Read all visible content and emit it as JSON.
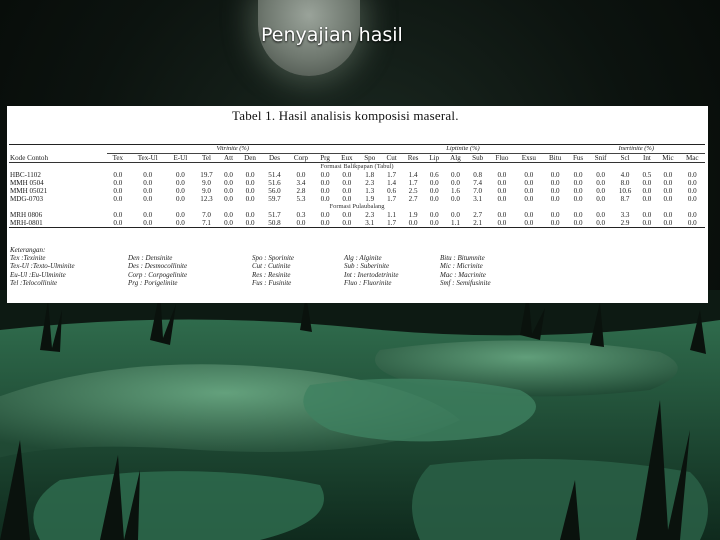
{
  "slide": {
    "title": "Penyajian hasil"
  },
  "table": {
    "caption": "Tabel 1. Hasil analisis komposisi maseral.",
    "groups": {
      "vitrinite": "Vitrinite (%)",
      "liptinite": "Liptinite (%)",
      "inertinite": "Inertinite (%)"
    },
    "kode_header": "Kode Contoh",
    "columns": [
      "Tex",
      "Tex-Ul",
      "E-Ul",
      "Tel",
      "Att",
      "Den",
      "Des",
      "Corp",
      "Prg",
      "Eux",
      "Spo",
      "Cut",
      "Res",
      "Lip",
      "Alg",
      "Sub",
      "Fluo",
      "Exsu",
      "Bitu",
      "Fus",
      "Snif",
      "Scl",
      "Int",
      "Mic",
      "Mac"
    ],
    "sections": [
      {
        "formation": "Formasi Balikpapan (Tabul)",
        "rows": [
          {
            "code": "HBC-1102",
            "values": [
              "0.0",
              "0.0",
              "0.0",
              "19.7",
              "0.0",
              "0.0",
              "51.4",
              "0.0",
              "0.0",
              "0.0",
              "1.8",
              "1.7",
              "1.4",
              "0.6",
              "0.0",
              "0.8",
              "0.0",
              "0.0",
              "0.0",
              "0.0",
              "0.0",
              "4.0",
              "0.5",
              "0.0",
              "0.0"
            ]
          },
          {
            "code": "MMH 0504",
            "values": [
              "0.0",
              "0.0",
              "0.0",
              "9.0",
              "0.0",
              "0.0",
              "51.6",
              "3.4",
              "0.0",
              "0.0",
              "2.3",
              "1.4",
              "1.7",
              "0.0",
              "0.0",
              "7.4",
              "0.0",
              "0.0",
              "0.0",
              "0.0",
              "0.0",
              "8.0",
              "0.0",
              "0.0",
              "0.0"
            ]
          },
          {
            "code": "MMH 05021",
            "values": [
              "0.0",
              "0.0",
              "0.0",
              "9.0",
              "0.0",
              "0.0",
              "56.0",
              "2.8",
              "0.0",
              "0.0",
              "1.3",
              "0.6",
              "2.5",
              "0.0",
              "1.6",
              "7.0",
              "0.0",
              "0.0",
              "0.0",
              "0.0",
              "0.0",
              "10.6",
              "0.0",
              "0.0",
              "0.0"
            ]
          },
          {
            "code": "MDG-0703",
            "values": [
              "0.0",
              "0.0",
              "0.0",
              "12.3",
              "0.0",
              "0.0",
              "59.7",
              "5.3",
              "0.0",
              "0.0",
              "1.9",
              "1.7",
              "2.7",
              "0.0",
              "0.0",
              "3.1",
              "0.0",
              "0.0",
              "0.0",
              "0.0",
              "0.0",
              "8.7",
              "0.0",
              "0.0",
              "0.0"
            ]
          }
        ]
      },
      {
        "formation": "Formasi Pulaubalang",
        "rows": [
          {
            "code": "MRH 0806",
            "values": [
              "0.0",
              "0.0",
              "0.0",
              "7.0",
              "0.0",
              "0.0",
              "51.7",
              "0.3",
              "0.0",
              "0.0",
              "2.3",
              "1.1",
              "1.9",
              "0.0",
              "0.0",
              "2.7",
              "0.0",
              "0.0",
              "0.0",
              "0.0",
              "0.0",
              "3.3",
              "0.0",
              "0.0",
              "0.0"
            ]
          },
          {
            "code": "MRH-0801",
            "values": [
              "0.0",
              "0.0",
              "0.0",
              "7.1",
              "0.0",
              "0.0",
              "50.8",
              "0.0",
              "0.0",
              "0.0",
              "3.1",
              "1.7",
              "0.0",
              "0.0",
              "1.1",
              "2.1",
              "0.0",
              "0.0",
              "0.0",
              "0.0",
              "0.0",
              "2.9",
              "0.0",
              "0.0",
              "0.0"
            ]
          }
        ]
      }
    ],
    "legend": {
      "heading": "Keterangan:",
      "columns": [
        [
          "Tex :Texinite",
          "Tex-Ul :Texto-Ulminite",
          "Eu-Ul :Eu-Ulminite",
          "Tel :Telocollinite"
        ],
        [
          "Den : Densinite",
          "Des : Desmocollinite",
          "Corp : Corpogelinite",
          "Prg : Porigelinite"
        ],
        [
          "Spo : Sporinite",
          "Cut : Cutinite",
          "Res : Resinite",
          "Fus : Fusinite"
        ],
        [
          "Alg : Alginite",
          "Sub : Suberinite",
          "Int : Inertodetrinite",
          "Fluo : Fluorinite"
        ],
        [
          "Bitu : Bitumnite",
          "Mic : Micrinite",
          "Mac : Macrinite",
          "Smf : Semifusinite"
        ]
      ]
    }
  }
}
